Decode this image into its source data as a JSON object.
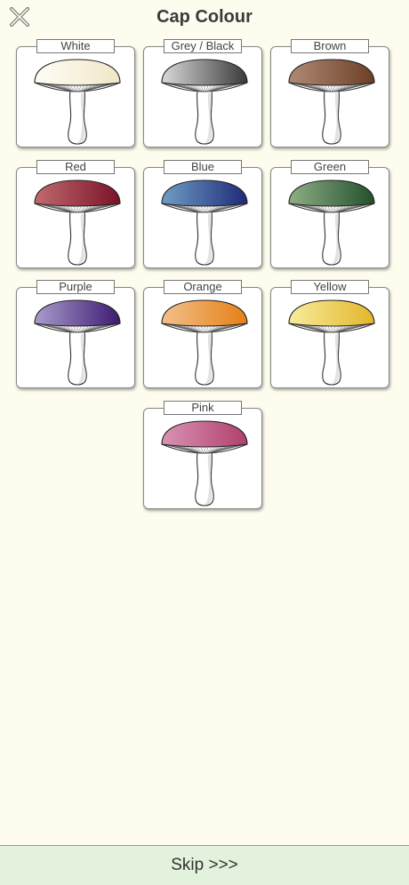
{
  "header": {
    "title": "Cap Colour",
    "close_icon": "close-icon"
  },
  "options": [
    {
      "label": "White",
      "colors": [
        "#fffdf5",
        "#f0e6c8"
      ]
    },
    {
      "label": "Grey / Black",
      "colors": [
        "#d9d9d9",
        "#3a3a3a"
      ]
    },
    {
      "label": "Brown",
      "colors": [
        "#b08a76",
        "#6b3f25"
      ]
    },
    {
      "label": "Red",
      "colors": [
        "#c06a6e",
        "#7a1228"
      ]
    },
    {
      "label": "Blue",
      "colors": [
        "#6f9ec4",
        "#1f2a78"
      ]
    },
    {
      "label": "Green",
      "colors": [
        "#8fae85",
        "#23502c"
      ]
    },
    {
      "label": "Purple",
      "colors": [
        "#a99ccd",
        "#3d1a70"
      ]
    },
    {
      "label": "Orange",
      "colors": [
        "#f2c08c",
        "#e67f14"
      ]
    },
    {
      "label": "Yellow",
      "colors": [
        "#f8ec9c",
        "#e3b52a"
      ]
    },
    {
      "label": "Pink",
      "colors": [
        "#d993b5",
        "#b13f6c"
      ]
    }
  ],
  "footer": {
    "skip_label": "Skip >>>"
  }
}
